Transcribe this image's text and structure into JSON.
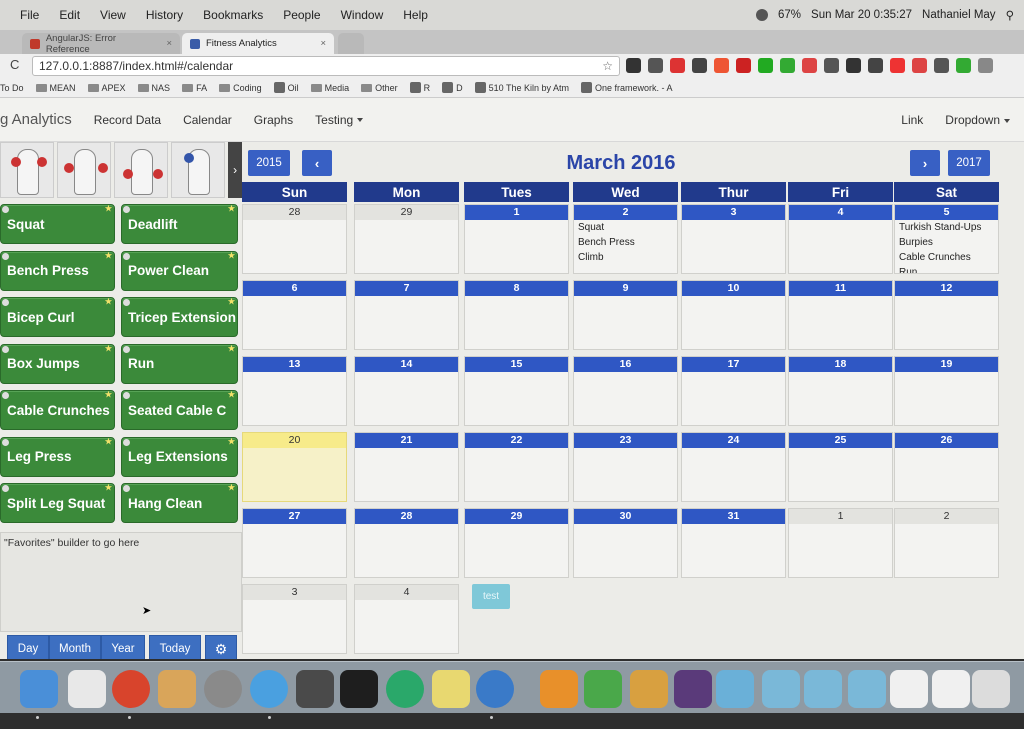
{
  "menubar": {
    "items": [
      "File",
      "Edit",
      "View",
      "History",
      "Bookmarks",
      "People",
      "Window",
      "Help"
    ],
    "battery": "67%",
    "clock": "Sun Mar 20  0:35:27",
    "user": "Nathaniel May"
  },
  "browser": {
    "tabs": [
      {
        "label": "AngularJS: Error Reference",
        "active": false,
        "favicon_color": "#c0392b"
      },
      {
        "label": "Fitness Analytics",
        "active": true,
        "favicon_color": "#3a5ca8"
      }
    ],
    "url": "127.0.0.1:8887/index.html#/calendar",
    "bookmarks": [
      {
        "label": "To Do",
        "type": "text"
      },
      {
        "label": "MEAN",
        "type": "folder"
      },
      {
        "label": "APEX",
        "type": "folder"
      },
      {
        "label": "NAS",
        "type": "folder"
      },
      {
        "label": "FA",
        "type": "folder"
      },
      {
        "label": "Coding",
        "type": "folder"
      },
      {
        "label": "Oil",
        "type": "site"
      },
      {
        "label": "Media",
        "type": "folder"
      },
      {
        "label": "Other",
        "type": "folder"
      },
      {
        "label": "R",
        "type": "site"
      },
      {
        "label": "D",
        "type": "site"
      },
      {
        "label": "510 The Kiln by Atm",
        "type": "site"
      },
      {
        "label": "One framework. - A",
        "type": "site"
      }
    ]
  },
  "navbar": {
    "brand": "g Analytics",
    "links": [
      "Record Data",
      "Calendar",
      "Graphs"
    ],
    "testing": "Testing",
    "right_link": "Link",
    "right_dropdown": "Dropdown"
  },
  "exercises": [
    {
      "label": "Squat"
    },
    {
      "label": "Deadlift"
    },
    {
      "label": "Bench Press"
    },
    {
      "label": "Power Clean"
    },
    {
      "label": "Bicep Curl"
    },
    {
      "label": "Tricep Extension"
    },
    {
      "label": "Box Jumps"
    },
    {
      "label": "Run"
    },
    {
      "label": "Cable Crunches"
    },
    {
      "label": "Seated Cable C"
    },
    {
      "label": "Leg Press"
    },
    {
      "label": "Leg Extensions"
    },
    {
      "label": "Split Leg Squat"
    },
    {
      "label": "Hang Clean"
    }
  ],
  "favorites_placeholder": "\"Favorites\" builder to go here",
  "view_buttons": {
    "day": "Day",
    "month": "Month",
    "year": "Year",
    "today": "Today",
    "settings_icon": "gear-icon"
  },
  "calendar": {
    "title": "March 2016",
    "prev_year": "2015",
    "next_year": "2017",
    "weekdays": [
      "Sun",
      "Mon",
      "Tues",
      "Wed",
      "Thur",
      "Fri",
      "Sat"
    ],
    "weeks": [
      [
        {
          "d": "28",
          "other": true
        },
        {
          "d": "29",
          "other": true
        },
        {
          "d": "1"
        },
        {
          "d": "2",
          "events": [
            "Squat",
            "Bench Press",
            "Climb"
          ]
        },
        {
          "d": "3"
        },
        {
          "d": "4"
        },
        {
          "d": "5",
          "events": [
            "Turkish Stand-Ups",
            "Burpies",
            "Cable Crunches",
            "Run"
          ]
        }
      ],
      [
        {
          "d": "6"
        },
        {
          "d": "7"
        },
        {
          "d": "8"
        },
        {
          "d": "9"
        },
        {
          "d": "10"
        },
        {
          "d": "11"
        },
        {
          "d": "12"
        }
      ],
      [
        {
          "d": "13"
        },
        {
          "d": "14"
        },
        {
          "d": "15"
        },
        {
          "d": "16"
        },
        {
          "d": "17"
        },
        {
          "d": "18"
        },
        {
          "d": "19"
        }
      ],
      [
        {
          "d": "20",
          "today": true
        },
        {
          "d": "21"
        },
        {
          "d": "22"
        },
        {
          "d": "23"
        },
        {
          "d": "24"
        },
        {
          "d": "25"
        },
        {
          "d": "26"
        }
      ],
      [
        {
          "d": "27"
        },
        {
          "d": "28"
        },
        {
          "d": "29"
        },
        {
          "d": "30"
        },
        {
          "d": "31"
        },
        {
          "d": "1",
          "other": true
        },
        {
          "d": "2",
          "other": true
        }
      ],
      [
        {
          "d": "3",
          "other": true
        },
        {
          "d": "4",
          "other": true
        }
      ]
    ],
    "test_button": "test"
  },
  "colors": {
    "accent_blue": "#2f57c4",
    "exercise_green": "#3b8a3a",
    "today_yellow": "#f7eb8a"
  }
}
